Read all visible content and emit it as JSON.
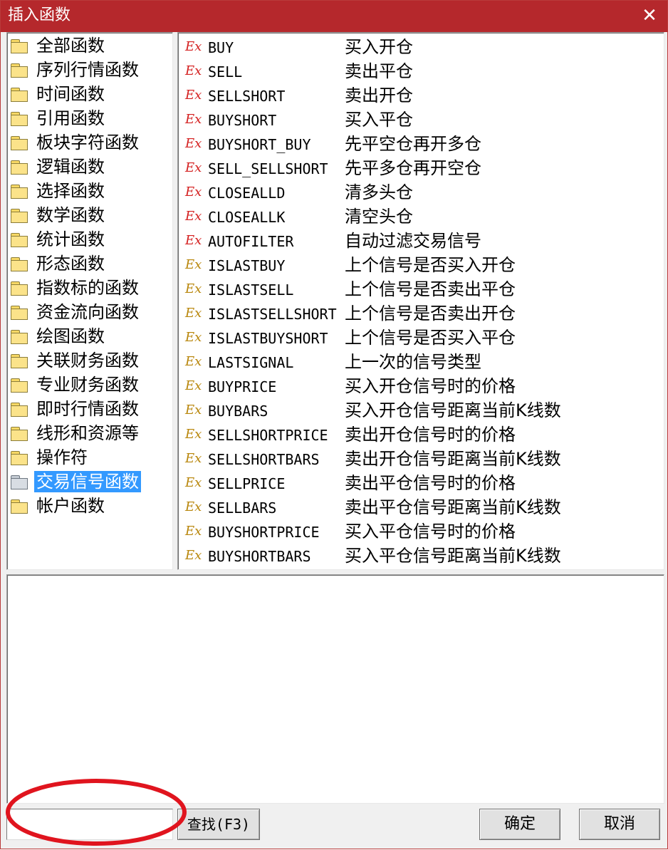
{
  "window": {
    "title": "插入函数",
    "close_glyph": "✕"
  },
  "categories": [
    {
      "label": "全部函数",
      "selected": false
    },
    {
      "label": "序列行情函数",
      "selected": false
    },
    {
      "label": "时间函数",
      "selected": false
    },
    {
      "label": "引用函数",
      "selected": false
    },
    {
      "label": "板块字符函数",
      "selected": false
    },
    {
      "label": "逻辑函数",
      "selected": false
    },
    {
      "label": "选择函数",
      "selected": false
    },
    {
      "label": "数学函数",
      "selected": false
    },
    {
      "label": "统计函数",
      "selected": false
    },
    {
      "label": "形态函数",
      "selected": false
    },
    {
      "label": "指数标的函数",
      "selected": false
    },
    {
      "label": "资金流向函数",
      "selected": false
    },
    {
      "label": "绘图函数",
      "selected": false
    },
    {
      "label": "关联财务函数",
      "selected": false
    },
    {
      "label": "专业财务函数",
      "selected": false
    },
    {
      "label": "即时行情函数",
      "selected": false
    },
    {
      "label": "线形和资源等",
      "selected": false
    },
    {
      "label": "操作符",
      "selected": false
    },
    {
      "label": "交易信号函数",
      "selected": true
    },
    {
      "label": "帐户函数",
      "selected": false
    }
  ],
  "functions": [
    {
      "icon": "Ex",
      "icon_color": "#d42020",
      "name": "BUY",
      "desc": "买入开仓"
    },
    {
      "icon": "Ex",
      "icon_color": "#d42020",
      "name": "SELL",
      "desc": "卖出平仓"
    },
    {
      "icon": "Ex",
      "icon_color": "#d42020",
      "name": "SELLSHORT",
      "desc": "卖出开仓"
    },
    {
      "icon": "Ex",
      "icon_color": "#d42020",
      "name": "BUYSHORT",
      "desc": "买入平仓"
    },
    {
      "icon": "Ex",
      "icon_color": "#d42020",
      "name": "BUYSHORT_BUY",
      "desc": "先平空仓再开多仓"
    },
    {
      "icon": "Ex",
      "icon_color": "#d42020",
      "name": "SELL_SELLSHORT",
      "desc": "先平多仓再开空仓"
    },
    {
      "icon": "Ex",
      "icon_color": "#d42020",
      "name": "CLOSEALLD",
      "desc": "清多头仓"
    },
    {
      "icon": "Ex",
      "icon_color": "#d42020",
      "name": "CLOSEALLK",
      "desc": "清空头仓"
    },
    {
      "icon": "Ex",
      "icon_color": "#d42020",
      "name": "AUTOFILTER",
      "desc": "自动过滤交易信号"
    },
    {
      "icon": "Ex",
      "icon_color": "#b8860b",
      "name": "ISLASTBUY",
      "desc": "上个信号是否买入开仓"
    },
    {
      "icon": "Ex",
      "icon_color": "#b8860b",
      "name": "ISLASTSELL",
      "desc": "上个信号是否卖出平仓"
    },
    {
      "icon": "Ex",
      "icon_color": "#b8860b",
      "name": "ISLASTSELLSHORT",
      "desc": "上个信号是否卖出开仓"
    },
    {
      "icon": "Ex",
      "icon_color": "#b8860b",
      "name": "ISLASTBUYSHORT",
      "desc": "上个信号是否买入平仓"
    },
    {
      "icon": "Ex",
      "icon_color": "#b8860b",
      "name": "LASTSIGNAL",
      "desc": "上一次的信号类型"
    },
    {
      "icon": "Ex",
      "icon_color": "#b8860b",
      "name": "BUYPRICE",
      "desc": "买入开仓信号时的价格"
    },
    {
      "icon": "Ex",
      "icon_color": "#b8860b",
      "name": "BUYBARS",
      "desc": "买入开仓信号距离当前K线数"
    },
    {
      "icon": "Ex",
      "icon_color": "#b8860b",
      "name": "SELLSHORTPRICE",
      "desc": "卖出开仓信号时的价格"
    },
    {
      "icon": "Ex",
      "icon_color": "#b8860b",
      "name": "SELLSHORTBARS",
      "desc": "卖出开仓信号距离当前K线数"
    },
    {
      "icon": "Ex",
      "icon_color": "#b8860b",
      "name": "SELLPRICE",
      "desc": "卖出平仓信号时的价格"
    },
    {
      "icon": "Ex",
      "icon_color": "#b8860b",
      "name": "SELLBARS",
      "desc": "卖出平仓信号距离当前K线数"
    },
    {
      "icon": "Ex",
      "icon_color": "#b8860b",
      "name": "BUYSHORTPRICE",
      "desc": "买入平仓信号时的价格"
    },
    {
      "icon": "Ex",
      "icon_color": "#b8860b",
      "name": "BUYSHORTBARS",
      "desc": "买入平仓信号距离当前K线数"
    }
  ],
  "description": {
    "text": ""
  },
  "footer": {
    "search_value": "",
    "find_label": "查找(F3)",
    "ok_label": "确定",
    "cancel_label": "取消"
  },
  "colors": {
    "titlebar": "#b5282c",
    "selection": "#3399ff",
    "annotation": "#e0141e"
  }
}
